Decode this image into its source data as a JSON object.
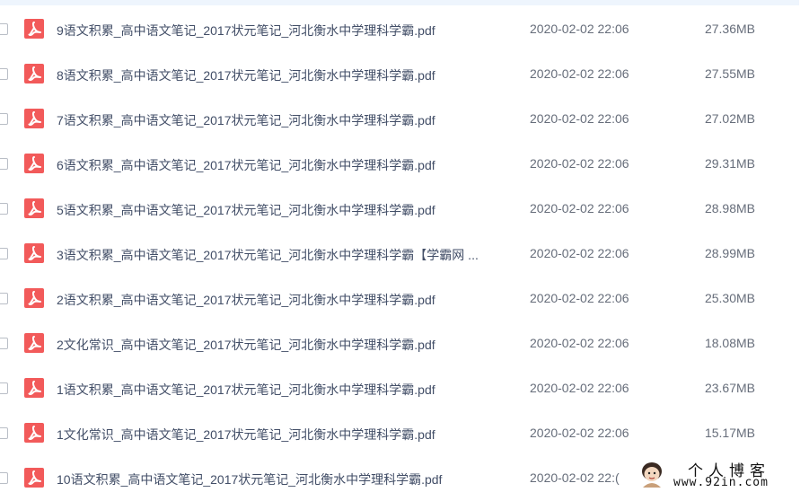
{
  "files": [
    {
      "name": "9语文积累_高中语文笔记_2017状元笔记_河北衡水中学理科学霸.pdf",
      "time": "2020-02-02 22:06",
      "size": "27.36MB",
      "icon": "pdf-icon"
    },
    {
      "name": "8语文积累_高中语文笔记_2017状元笔记_河北衡水中学理科学霸.pdf",
      "time": "2020-02-02 22:06",
      "size": "27.55MB",
      "icon": "pdf-icon"
    },
    {
      "name": "7语文积累_高中语文笔记_2017状元笔记_河北衡水中学理科学霸.pdf",
      "time": "2020-02-02 22:06",
      "size": "27.02MB",
      "icon": "pdf-icon"
    },
    {
      "name": "6语文积累_高中语文笔记_2017状元笔记_河北衡水中学理科学霸.pdf",
      "time": "2020-02-02 22:06",
      "size": "29.31MB",
      "icon": "pdf-icon"
    },
    {
      "name": "5语文积累_高中语文笔记_2017状元笔记_河北衡水中学理科学霸.pdf",
      "time": "2020-02-02 22:06",
      "size": "28.98MB",
      "icon": "pdf-icon"
    },
    {
      "name": "3语文积累_高中语文笔记_2017状元笔记_河北衡水中学理科学霸【学霸网 ...",
      "time": "2020-02-02 22:06",
      "size": "28.99MB",
      "icon": "pdf-icon"
    },
    {
      "name": "2语文积累_高中语文笔记_2017状元笔记_河北衡水中学理科学霸.pdf",
      "time": "2020-02-02 22:06",
      "size": "25.30MB",
      "icon": "pdf-icon"
    },
    {
      "name": "2文化常识_高中语文笔记_2017状元笔记_河北衡水中学理科学霸.pdf",
      "time": "2020-02-02 22:06",
      "size": "18.08MB",
      "icon": "pdf-icon"
    },
    {
      "name": "1语文积累_高中语文笔记_2017状元笔记_河北衡水中学理科学霸.pdf",
      "time": "2020-02-02 22:06",
      "size": "23.67MB",
      "icon": "pdf-icon"
    },
    {
      "name": "1文化常识_高中语文笔记_2017状元笔记_河北衡水中学理科学霸.pdf",
      "time": "2020-02-02 22:06",
      "size": "15.17MB",
      "icon": "pdf-icon"
    },
    {
      "name": "10语文积累_高中语文笔记_2017状元笔记_河北衡水中学理科学霸.pdf",
      "time": "2020-02-02 22:(",
      "size": "",
      "icon": "pdf-icon"
    }
  ],
  "watermark": {
    "title": "个人博客",
    "url": "www.92in.com"
  },
  "colors": {
    "pdf_icon": "#f25a5a",
    "filename_text": "#424e67",
    "meta_text": "#666d7a",
    "top_strip": "#eef5fd"
  }
}
